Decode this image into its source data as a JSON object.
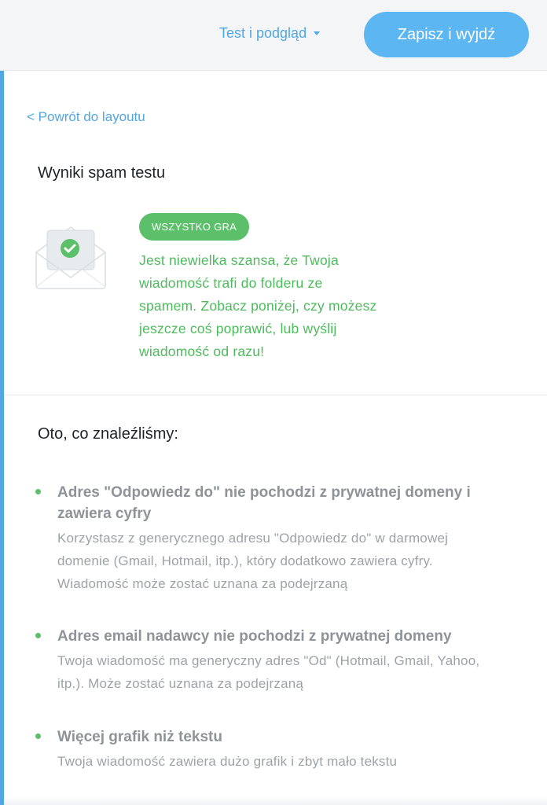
{
  "header": {
    "preview_label": "Test i podgląd",
    "save_label": "Zapisz i wyjdź"
  },
  "main": {
    "back_link": "< Powrót do layoutu",
    "title": "Wyniki spam testu",
    "badge": "WSZYSTKO GRA",
    "result_lines": [
      "Jest niewielka szansa, że Twoja",
      "wiadomość trafi do folderu ze",
      "spamem. Zobacz poniżej, czy możesz",
      "jeszcze coś poprawić, lub wyślij",
      "wiadomość od razu!"
    ],
    "findings_title": "Oto, co znaleźliśmy:",
    "findings": [
      {
        "title_lines": [
          "Adres \"Odpowiedz do\" nie pochodzi z prywatnej domeny i",
          "zawiera cyfry"
        ],
        "desc_lines": [
          "Korzystasz z generycznego adresu \"Odpowiedz do\" w darmowej",
          "domenie (Gmail, Hotmail, itp.), który dodatkowo zawiera cyfry.",
          "Wiadomość może zostać uznana za podejrzaną"
        ]
      },
      {
        "title_lines": [
          "Adres email nadawcy nie pochodzi z prywatnej domeny"
        ],
        "desc_lines": [
          "Twoja wiadomość ma generyczny adres \"Od\" (Hotmail, Gmail, Yahoo,",
          "itp.). Może zostać uznana za podejrzaną"
        ]
      },
      {
        "title_lines": [
          "Więcej grafik niż tekstu"
        ],
        "desc_lines": [
          "Twoja wiadomość zawiera dużo grafik i zbyt mało tekstu"
        ]
      }
    ]
  },
  "colors": {
    "accent": "#4fa7e4",
    "button": "#5cb6f2",
    "success": "#5cbf6a",
    "success_text": "#4dba5c",
    "topbar_bg": "#f4f5f7"
  },
  "icons": {
    "dropdown": "caret-down-icon",
    "envelope": "envelope-check-icon"
  }
}
